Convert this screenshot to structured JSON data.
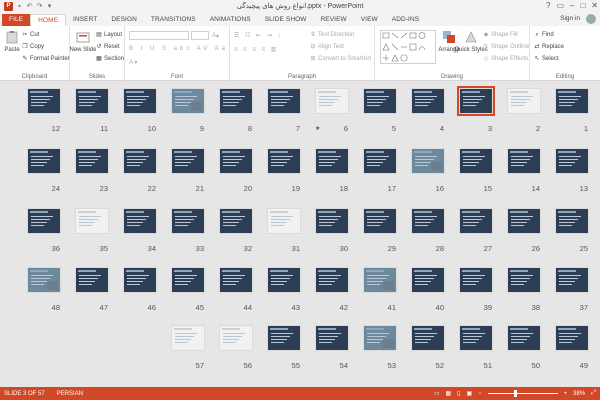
{
  "window": {
    "title": "انواع روش های پیچیدگی.pptx - PowerPoint",
    "minimize_icon": "minimize-icon",
    "close_icon": "close-icon"
  },
  "tabs": [
    {
      "label": "FILE"
    },
    {
      "label": "HOME"
    },
    {
      "label": "INSERT"
    },
    {
      "label": "DESIGN"
    },
    {
      "label": "TRANSITIONS"
    },
    {
      "label": "ANIMATIONS"
    },
    {
      "label": "SLIDE SHOW"
    },
    {
      "label": "REVIEW"
    },
    {
      "label": "VIEW"
    },
    {
      "label": "ADD-INS"
    }
  ],
  "account": {
    "signin": "Sign in"
  },
  "ribbon": {
    "clipboard": {
      "label": "Clipboard",
      "paste": "Paste",
      "cut": "Cut",
      "copy": "Copy",
      "format_painter": "Format Painter"
    },
    "slides": {
      "label": "Slides",
      "new_slide": "New Slide",
      "layout": "Layout",
      "reset": "Reset",
      "section": "Section"
    },
    "font": {
      "label": "Font"
    },
    "paragraph": {
      "label": "Paragraph",
      "text_direction": "Text Direction",
      "align_text": "Align Text",
      "convert_smartart": "Convert to SmartArt"
    },
    "drawing": {
      "label": "Drawing",
      "arrange": "Arrange",
      "quick_styles": "Quick Styles",
      "shape_fill": "Shape Fill",
      "shape_outline": "Shape Outline",
      "shape_effects": "Shape Effects"
    },
    "editing": {
      "label": "Editing",
      "find": "Find",
      "replace": "Replace",
      "select": "Select"
    }
  },
  "slides": [
    {
      "n": "1",
      "style": "dark"
    },
    {
      "n": "2",
      "style": "white"
    },
    {
      "n": "3",
      "style": "dark"
    },
    {
      "n": "4",
      "style": "dark"
    },
    {
      "n": "5",
      "style": "dark"
    },
    {
      "n": "6",
      "style": "white"
    },
    {
      "n": "7",
      "style": "dark"
    },
    {
      "n": "8",
      "style": "dark"
    },
    {
      "n": "9",
      "style": "photo"
    },
    {
      "n": "10",
      "style": "dark"
    },
    {
      "n": "11",
      "style": "dark"
    },
    {
      "n": "12",
      "style": "dark"
    },
    {
      "n": "13",
      "style": "dark"
    },
    {
      "n": "14",
      "style": "dark"
    },
    {
      "n": "15",
      "style": "dark"
    },
    {
      "n": "16",
      "style": "photo"
    },
    {
      "n": "17",
      "style": "dark"
    },
    {
      "n": "18",
      "style": "dark"
    },
    {
      "n": "19",
      "style": "dark"
    },
    {
      "n": "20",
      "style": "dark"
    },
    {
      "n": "21",
      "style": "dark"
    },
    {
      "n": "22",
      "style": "dark"
    },
    {
      "n": "23",
      "style": "dark"
    },
    {
      "n": "24",
      "style": "dark"
    },
    {
      "n": "25",
      "style": "dark"
    },
    {
      "n": "26",
      "style": "dark"
    },
    {
      "n": "27",
      "style": "dark"
    },
    {
      "n": "28",
      "style": "dark"
    },
    {
      "n": "29",
      "style": "dark"
    },
    {
      "n": "30",
      "style": "dark"
    },
    {
      "n": "31",
      "style": "white"
    },
    {
      "n": "32",
      "style": "dark"
    },
    {
      "n": "33",
      "style": "dark"
    },
    {
      "n": "34",
      "style": "dark"
    },
    {
      "n": "35",
      "style": "white"
    },
    {
      "n": "36",
      "style": "dark"
    },
    {
      "n": "37",
      "style": "dark"
    },
    {
      "n": "38",
      "style": "dark"
    },
    {
      "n": "39",
      "style": "dark"
    },
    {
      "n": "40",
      "style": "dark"
    },
    {
      "n": "41",
      "style": "photo"
    },
    {
      "n": "42",
      "style": "dark"
    },
    {
      "n": "43",
      "style": "dark"
    },
    {
      "n": "44",
      "style": "dark"
    },
    {
      "n": "45",
      "style": "dark"
    },
    {
      "n": "46",
      "style": "dark"
    },
    {
      "n": "47",
      "style": "dark"
    },
    {
      "n": "48",
      "style": "photo"
    },
    {
      "n": "49",
      "style": "dark"
    },
    {
      "n": "50",
      "style": "dark"
    },
    {
      "n": "51",
      "style": "dark"
    },
    {
      "n": "52",
      "style": "dark"
    },
    {
      "n": "53",
      "style": "photo"
    },
    {
      "n": "54",
      "style": "dark"
    },
    {
      "n": "55",
      "style": "dark"
    },
    {
      "n": "56",
      "style": "white"
    },
    {
      "n": "57",
      "style": "white"
    }
  ],
  "selected_slide": "3",
  "transition_mark": "★",
  "status": {
    "slide": "SLIDE 3 OF 57",
    "language": "PERSIAN",
    "zoom": "38%",
    "zoom_minus": "−",
    "zoom_plus": "+",
    "zoom_fraction": 0.38
  }
}
